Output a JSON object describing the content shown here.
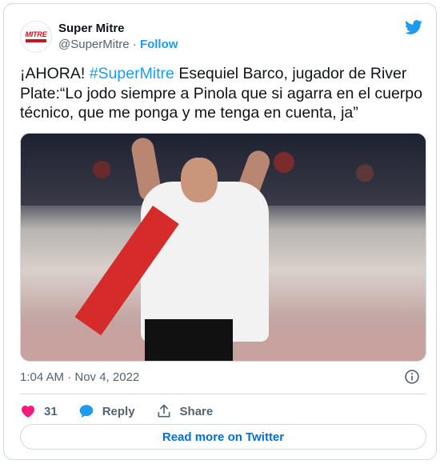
{
  "account": {
    "name": "Super Mitre",
    "handle": "@SuperMitre",
    "separator": "·",
    "follow_label": "Follow",
    "avatar_logo_text": "MITRE"
  },
  "tweet": {
    "text_prefix": "¡AHORA! ",
    "hashtag": "#SuperMitre",
    "text_body": " Esequiel Barco, jugador de River Plate:“Lo jodo siempre  a Pinola que si agarra en el cuerpo técnico, que me ponga y me tenga en cuenta, ja”",
    "timestamp": "1:04 AM · Nov 4, 2022"
  },
  "actions": {
    "likes_count": "31",
    "reply_label": "Reply",
    "share_label": "Share"
  },
  "read_more_label": "Read more on Twitter",
  "colors": {
    "accent": "#1d9bf0",
    "like": "#f91880",
    "text_secondary": "#536471",
    "border": "#cfd9de"
  },
  "icons": {
    "brand": "twitter-bird-icon",
    "info": "info-icon",
    "like": "heart-icon",
    "reply": "speech-bubble-icon",
    "share": "upload-icon"
  }
}
